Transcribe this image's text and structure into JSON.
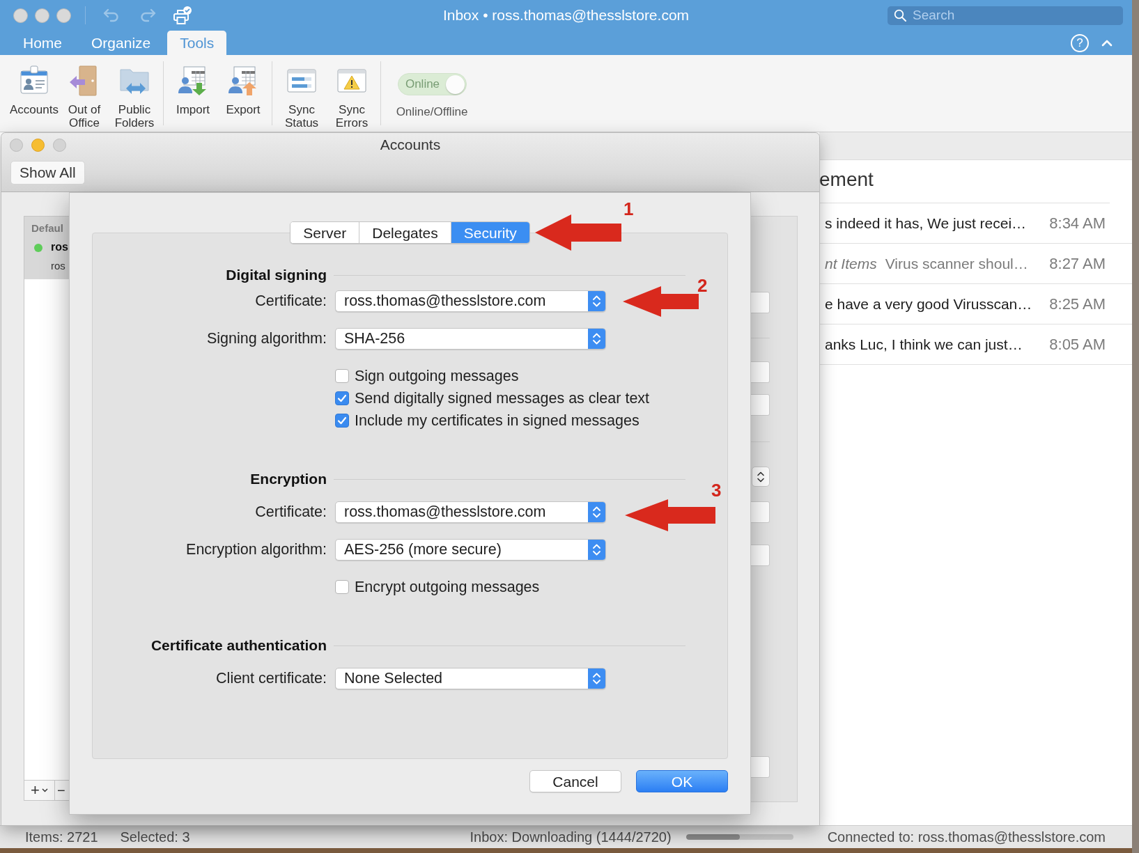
{
  "window": {
    "title": "Inbox • ross.thomas@thesslstore.com",
    "quick_access": [
      {
        "kind": "undo",
        "disabled": true
      },
      {
        "kind": "redo",
        "disabled": true
      },
      {
        "kind": "print",
        "disabled": false
      }
    ],
    "search": {
      "placeholder": "Search"
    },
    "help_button": "?"
  },
  "ribbon": {
    "tabs": [
      {
        "label": "Home",
        "selected": false
      },
      {
        "label": "Organize",
        "selected": false
      },
      {
        "label": "Tools",
        "selected": true
      }
    ],
    "groups": [
      {
        "buttons": [
          {
            "label": "Accounts"
          },
          {
            "label": "Out of Office"
          },
          {
            "label": "Public Folders"
          }
        ]
      },
      {
        "buttons": [
          {
            "label": "Import"
          },
          {
            "label": "Export"
          }
        ]
      },
      {
        "buttons": [
          {
            "label": "Sync Status"
          },
          {
            "label": "Sync Errors"
          }
        ]
      }
    ],
    "online_toggle": {
      "text": "Online",
      "label": "Online/Offline",
      "on": true,
      "disabled": true
    }
  },
  "message_list": {
    "heading": "ement",
    "messages": [
      {
        "preview": "s indeed it has, We just recei…",
        "time": "8:34 AM",
        "dimmed": false
      },
      {
        "folder": "nt Items",
        "preview": "Virus scanner shoul…",
        "time": "8:27 AM",
        "dimmed": true
      },
      {
        "preview": "e have a very good Virusscan…",
        "time": "8:25 AM",
        "dimmed": false
      },
      {
        "preview": "anks Luc, I think we can just…",
        "time": "8:05 AM",
        "dimmed": false
      }
    ]
  },
  "accounts_window": {
    "title": "Accounts",
    "show_all_button": "Show All",
    "account_list": {
      "group": "Defaul",
      "accounts": [
        {
          "name": "ros",
          "email": "ros",
          "color": "#5fcd5a",
          "selected": true
        }
      ],
      "add_button": "+",
      "remove_button": "−"
    }
  },
  "account_settings": {
    "tabs": [
      {
        "label": "Server",
        "selected": false
      },
      {
        "label": "Delegates",
        "selected": false
      },
      {
        "label": "Security",
        "selected": true
      }
    ],
    "sections": [
      {
        "title": "Digital signing",
        "rows": [
          {
            "kind": "popup",
            "label": "Certificate:",
            "value": "ross.thomas@thesslstore.com"
          },
          {
            "kind": "popup",
            "label": "Signing algorithm:",
            "value": "SHA-256"
          },
          {
            "kind": "checkbox",
            "label": "Sign outgoing messages",
            "checked": false
          },
          {
            "kind": "checkbox",
            "label": "Send digitally signed messages as clear text",
            "checked": true
          },
          {
            "kind": "checkbox",
            "label": "Include my certificates in signed messages",
            "checked": true
          }
        ]
      },
      {
        "title": "Encryption",
        "rows": [
          {
            "kind": "popup",
            "label": "Certificate:",
            "value": "ross.thomas@thesslstore.com"
          },
          {
            "kind": "popup",
            "label": "Encryption algorithm:",
            "value": "AES-256 (more secure)"
          },
          {
            "kind": "checkbox",
            "label": "Encrypt outgoing messages",
            "checked": false
          }
        ]
      },
      {
        "title": "Certificate authentication",
        "rows": [
          {
            "kind": "popup",
            "label": "Client certificate:",
            "value": "None Selected"
          }
        ]
      }
    ],
    "buttons": [
      {
        "label": "Cancel",
        "default": false
      },
      {
        "label": "OK",
        "default": true
      }
    ]
  },
  "callouts": [
    {
      "label": "1"
    },
    {
      "label": "2"
    },
    {
      "label": "3"
    }
  ],
  "status_bar": {
    "items": "Items: 2721",
    "selected": "Selected: 3",
    "sync": "Inbox: Downloading (1444/2720)",
    "progress": {
      "level": 0.5
    },
    "connection": "Connected to: ross.thomas@thesslstore.com"
  }
}
